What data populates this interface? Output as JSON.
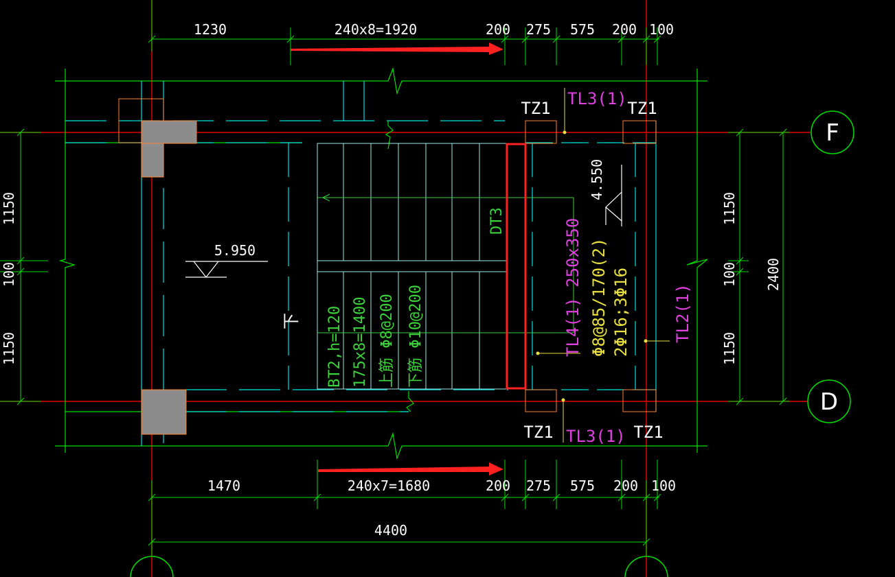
{
  "colors": {
    "background": "#000000",
    "dimension": "#00e000",
    "axis_line": "#e00000",
    "wall": "#00e0e0",
    "column": "#ff8030",
    "beam_label": "#e040e0",
    "rebar_label": "#e8e040",
    "highlight": "#ff2020"
  },
  "top_dims": {
    "d1": "1230",
    "d2": "240x8=1920",
    "d3": "200",
    "d4": "275",
    "d5": "575",
    "d6": "200",
    "d7": "100"
  },
  "bottom_dims": {
    "d1": "1470",
    "d2": "240x7=1680",
    "d3": "200",
    "d4": "275",
    "d5": "575",
    "d6": "200",
    "d7": "100",
    "total": "4400"
  },
  "left_dims": {
    "d1": "1150",
    "d2": "100",
    "d3": "1150"
  },
  "right_dims": {
    "d1": "1150",
    "d2": "100",
    "d3": "1150",
    "total": "2400"
  },
  "axes": {
    "top": "F",
    "bottom": "D"
  },
  "labels": {
    "tz1_tl": "TZ1",
    "tz1_tr": "TZ1",
    "tz1_bl": "TZ1",
    "tz1_br": "TZ1",
    "tl3_top": "TL3(1)",
    "tl3_bottom": "TL3(1)",
    "tl2": "TL2(1)",
    "tl4": "TL4(1) 250x350",
    "tl4_stirrup": "Φ8@85/170(2)",
    "tl4_bars": "2Φ16;3Φ16",
    "dt3": "DT3",
    "elev_left": "5.950",
    "elev_right": "4.550",
    "down": "下",
    "bt2": "BT2,h=120",
    "bt2_steps": "175x8=1400",
    "bt2_top": "上筋 Φ8@200",
    "bt2_bottom": "下筋 Φ10@200"
  }
}
